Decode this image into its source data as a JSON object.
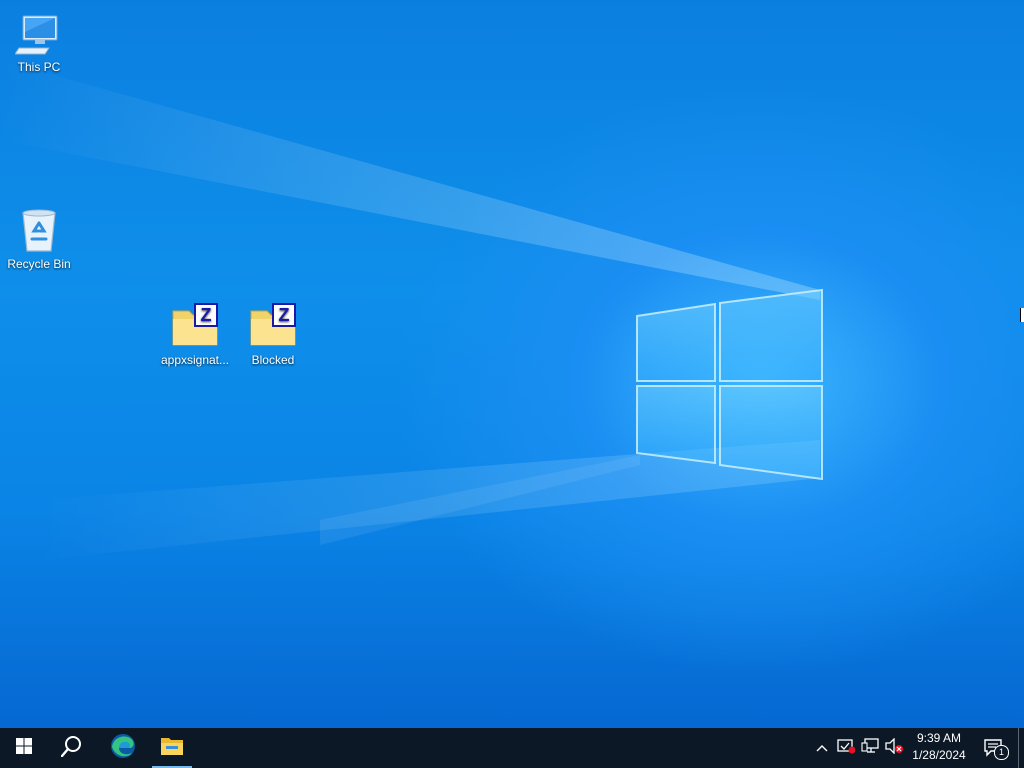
{
  "desktop": {
    "icons": [
      {
        "label": "This PC",
        "icon": "computer-icon"
      },
      {
        "label": "Recycle Bin",
        "icon": "recycle-bin-icon"
      },
      {
        "label": "appxsignat...",
        "icon": "zip-folder-icon"
      },
      {
        "label": "Blocked",
        "icon": "zip-folder-icon"
      }
    ],
    "wallpaper": {
      "accent": "#0a84e6",
      "light": "#3fb7ff"
    }
  },
  "taskbar": {
    "background": "#0c1826",
    "start_icon": "windows-start-icon",
    "search_icon": "search-icon",
    "pinned": [
      {
        "name": "Microsoft Edge",
        "icon": "edge-icon"
      },
      {
        "name": "File Explorer",
        "icon": "file-explorer-icon",
        "active": true
      }
    ],
    "tray": {
      "icons": [
        "chevron-up-icon",
        "security-icon",
        "network-icon",
        "volume-muted-icon"
      ],
      "time": "9:39 AM",
      "date": "1/28/2024",
      "notification_count": "1"
    }
  }
}
